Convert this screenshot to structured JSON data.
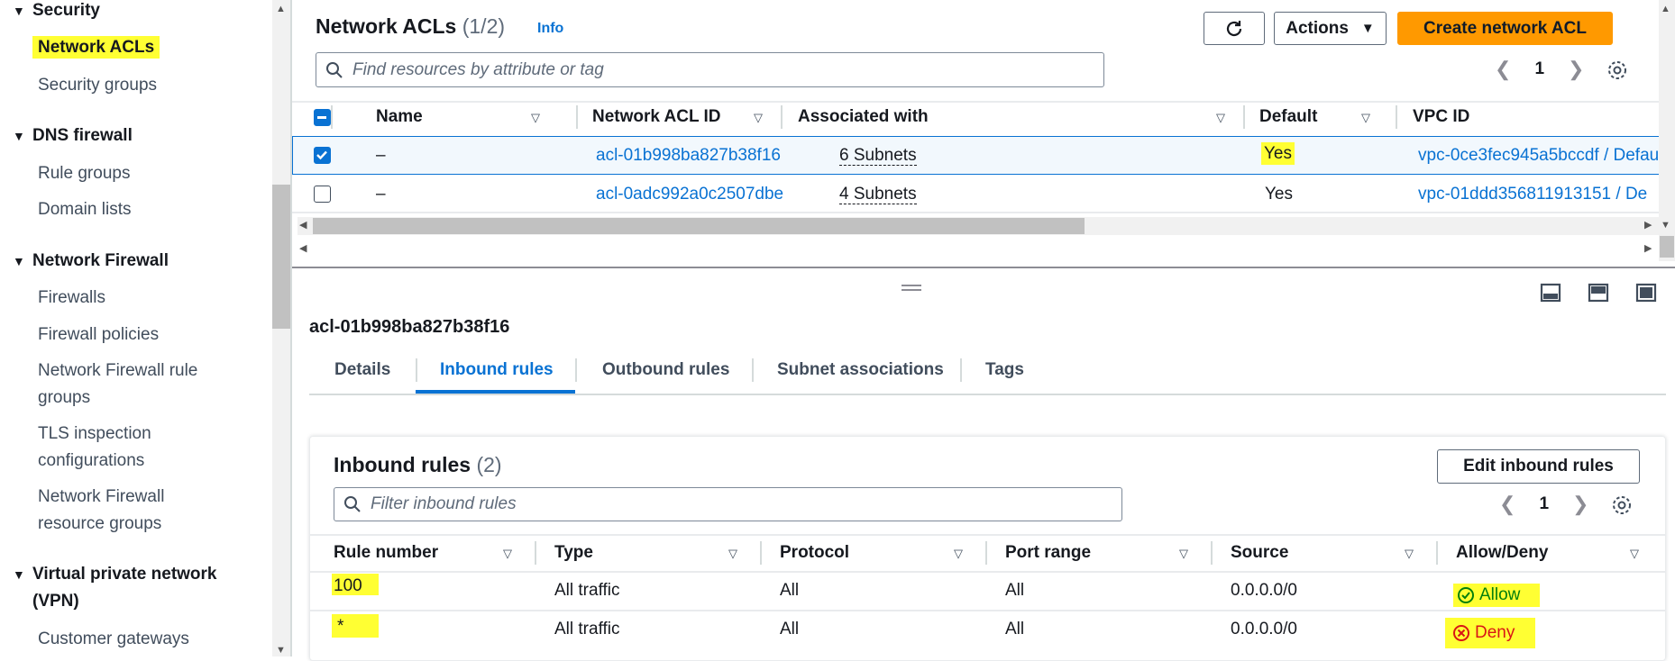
{
  "sidebar": {
    "sections": [
      {
        "label": "Security",
        "items": [
          "Network ACLs",
          "Security groups"
        ]
      },
      {
        "label": "DNS firewall",
        "items": [
          "Rule groups",
          "Domain lists"
        ]
      },
      {
        "label": "Network Firewall",
        "items": [
          "Firewalls",
          "Firewall policies",
          "Network Firewall rule",
          "groups",
          "TLS inspection",
          "configurations",
          "Network Firewall",
          "resource groups"
        ]
      },
      {
        "label": "Virtual private network",
        "label2": "(VPN)",
        "items": [
          "Customer gateways"
        ]
      }
    ]
  },
  "header": {
    "title": "Network ACLs",
    "count": "(1/2)",
    "info": "Info",
    "actions_label": "Actions",
    "create_label": "Create network ACL",
    "search_placeholder": "Find resources by attribute or tag",
    "page": "1"
  },
  "acl_table": {
    "columns": [
      "Name",
      "Network ACL ID",
      "Associated with",
      "Default",
      "VPC ID"
    ],
    "rows": [
      {
        "name": "–",
        "id": "acl-01b998ba827b38f16",
        "assoc": "6 Subnets",
        "default": "Yes",
        "vpc": "vpc-0ce3fec945a5bccdf / Defau",
        "selected": true
      },
      {
        "name": "–",
        "id": "acl-0adc992a0c2507dbe",
        "assoc": "4 Subnets",
        "default": "Yes",
        "vpc": "vpc-01ddd356811913151 / De",
        "selected": false
      }
    ]
  },
  "detail": {
    "acl_id": "acl-01b998ba827b38f16",
    "tabs": [
      "Details",
      "Inbound rules",
      "Outbound rules",
      "Subnet associations",
      "Tags"
    ],
    "active_tab": "Inbound rules"
  },
  "inbound": {
    "title": "Inbound rules",
    "count": "(2)",
    "edit_label": "Edit inbound rules",
    "filter_placeholder": "Filter inbound rules",
    "page": "1",
    "columns": [
      "Rule number",
      "Type",
      "Protocol",
      "Port range",
      "Source",
      "Allow/Deny"
    ],
    "rows": [
      {
        "rule": "100",
        "type": "All traffic",
        "protocol": "All",
        "port": "All",
        "source": "0.0.0.0/0",
        "action": "Allow"
      },
      {
        "rule": "*",
        "type": "All traffic",
        "protocol": "All",
        "port": "All",
        "source": "0.0.0.0/0",
        "action": "Deny"
      }
    ]
  },
  "colors": {
    "link": "#0972d3",
    "primary": "#ff9900",
    "allow": "#037f0c",
    "deny": "#d91515",
    "highlight": "#ffff33"
  }
}
